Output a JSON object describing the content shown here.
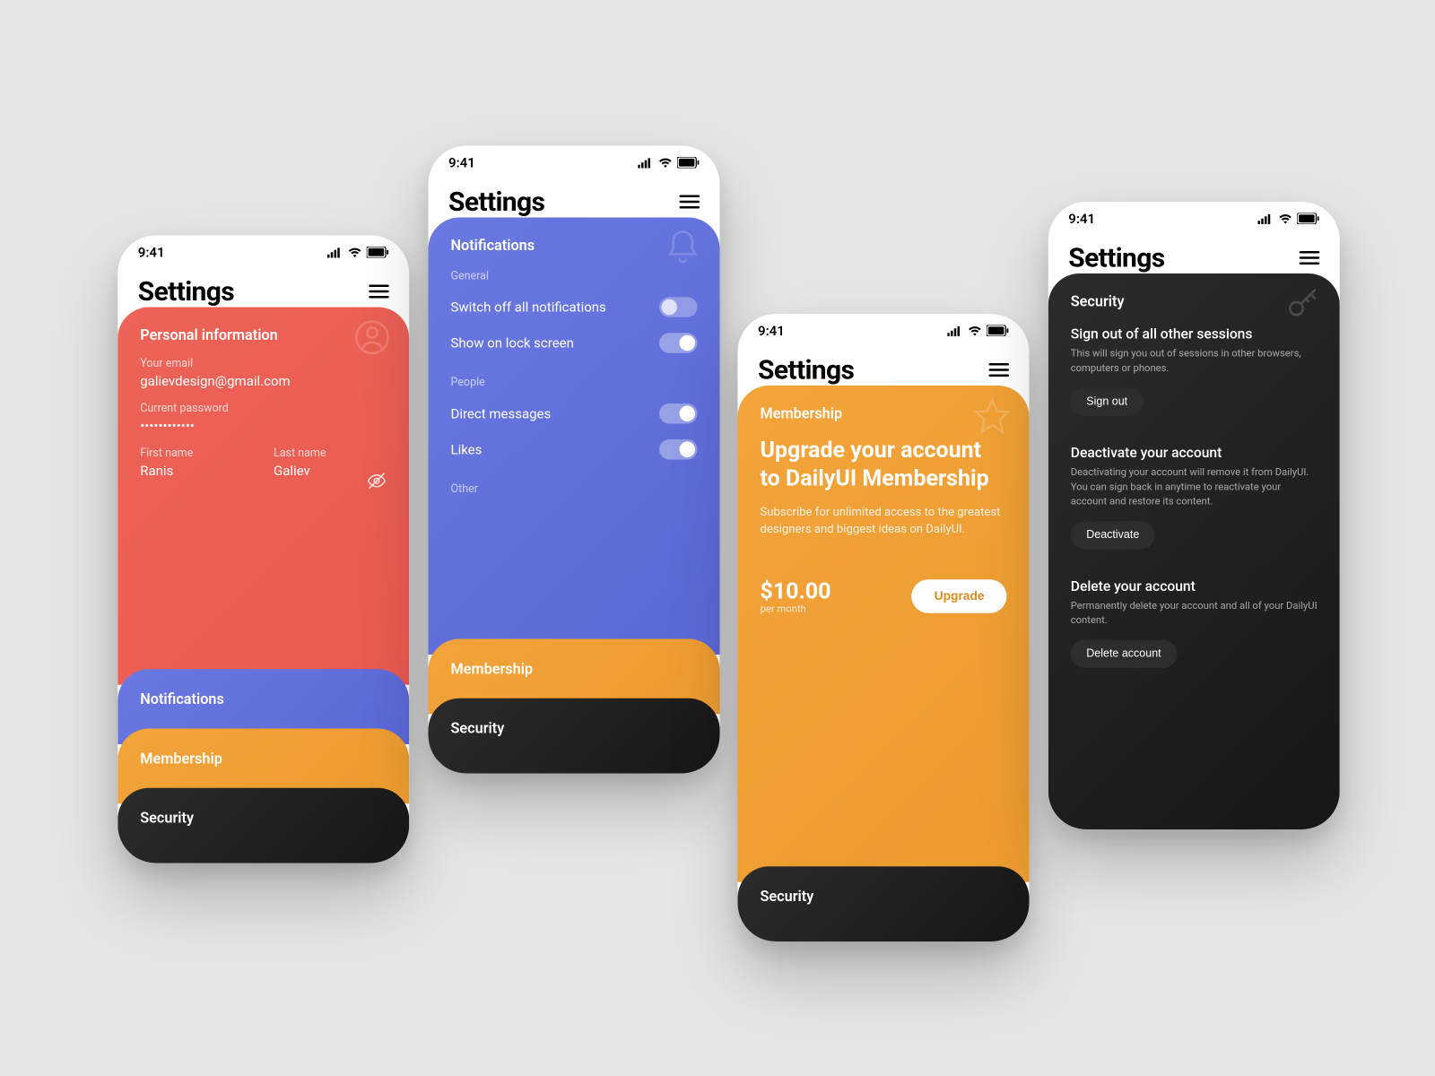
{
  "status": {
    "time": "9:41"
  },
  "header": {
    "title": "Settings"
  },
  "sections": {
    "personal": "Personal information",
    "notifications": "Notifications",
    "membership": "Membership",
    "security": "Security"
  },
  "personal": {
    "email_label": "Your email",
    "email": "galievdesign@gmail.com",
    "password_label": "Current password",
    "password_mask": "••••••••••••",
    "first_label": "First name",
    "first": "Ranis",
    "last_label": "Last name",
    "last": "Galiev"
  },
  "notifications": {
    "group_general": "General",
    "switch_off": "Switch off all notifications",
    "lock_screen": "Show on lock screen",
    "group_people": "People",
    "dm": "Direct messages",
    "likes": "Likes",
    "group_other": "Other"
  },
  "membership": {
    "headline": "Upgrade your account to DailyUI Membership",
    "subtext": "Subscribe for unlimited access to the greatest designers and biggest ideas on DailyUI.",
    "price": "$10.00",
    "period": "per month",
    "cta": "Upgrade"
  },
  "security": {
    "signout_title": "Sign out of all other sessions",
    "signout_desc": "This will sign you out of sessions in other browsers, computers or phones.",
    "signout_btn": "Sign out",
    "deact_title": "Deactivate your account",
    "deact_desc": "Deactivating your account will remove it from DailyUI. You can sign back in anytime to reactivate your account and restore its content.",
    "deact_btn": "Deactivate",
    "delete_title": "Delete your account",
    "delete_desc": "Permanently delete your account and all of your DailyUI content.",
    "delete_btn": "Delete account"
  }
}
